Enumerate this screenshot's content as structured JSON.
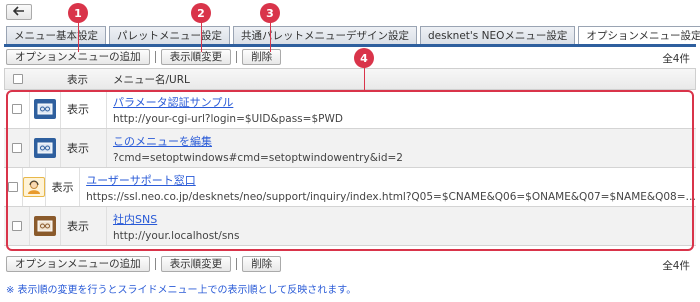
{
  "tabs": [
    {
      "label": "メニュー基本設定"
    },
    {
      "label": "パレットメニュー設定"
    },
    {
      "label": "共通パレットメニューデザイン設定"
    },
    {
      "label": "desknet's NEOメニュー設定"
    },
    {
      "label": "オプションメニュー設定"
    }
  ],
  "toolbar": {
    "add_label": "オプションメニューの追加",
    "reorder_label": "表示順変更",
    "delete_label": "削除",
    "count": "全4件"
  },
  "table": {
    "headers": {
      "display": "表示",
      "name": "メニュー名/URL"
    },
    "rows": [
      {
        "display": "表示",
        "name": "パラメータ認証サンプル",
        "url": "http://your-cgi-url?login=$UID&pass=$PWD",
        "icon": "window-icon"
      },
      {
        "display": "表示",
        "name": "このメニューを編集",
        "url": "?cmd=setoptwindows#cmd=setoptwindowentry&id=2",
        "icon": "window-icon"
      },
      {
        "display": "表示",
        "name": "ユーザーサポート窓口",
        "url": "https://ssl.neo.co.jp/desknets/neo/support/inquiry/index.html?Q05=$CNAME&Q06=$ONAME&Q07=$NAME&Q08=…",
        "icon": "support-person-icon"
      },
      {
        "display": "表示",
        "name": "社内SNS",
        "url": "http://your.localhost/sns",
        "icon": "window-icon"
      }
    ]
  },
  "note": "※ 表示順の変更を行うとスライドメニュー上での表示順として反映されます。",
  "markers": [
    "1",
    "2",
    "3",
    "4"
  ],
  "colors": {
    "accent": "#2e5f9e",
    "link": "#2a5bd7",
    "annotation": "#d9344a"
  }
}
